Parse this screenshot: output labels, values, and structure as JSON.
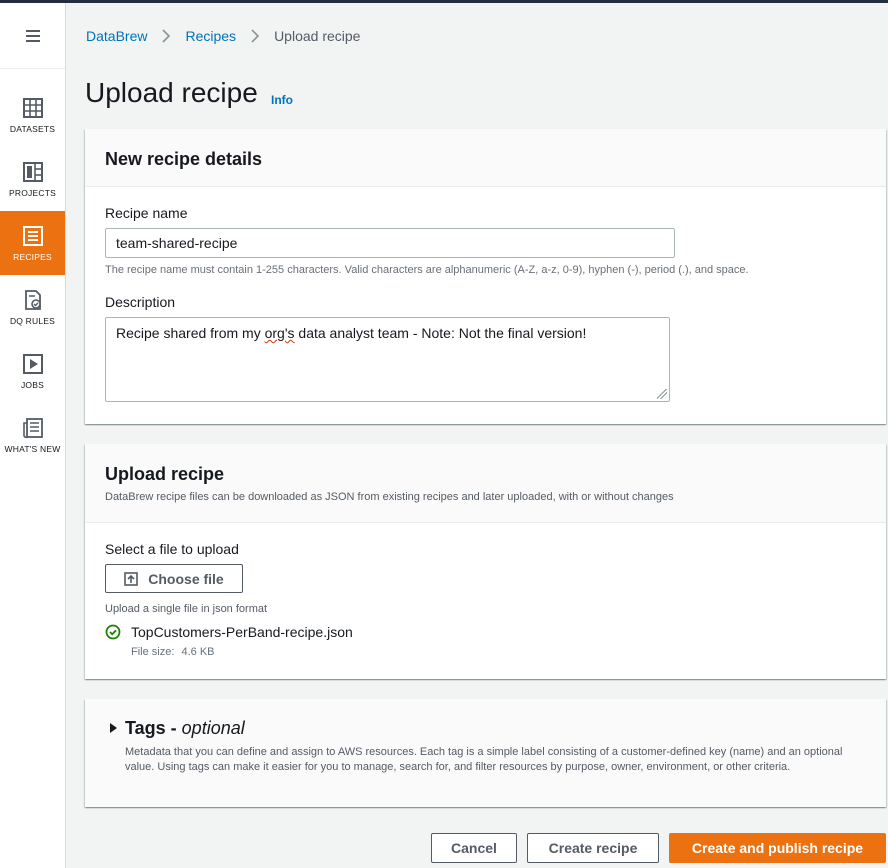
{
  "nav": {
    "menu_icon": "hamburger-menu-icon",
    "items": [
      {
        "label": "DATASETS",
        "icon": "table-grid-icon",
        "active": false
      },
      {
        "label": "PROJECTS",
        "icon": "project-grid-icon",
        "active": false
      },
      {
        "label": "RECIPES",
        "icon": "recipe-list-icon",
        "active": true
      },
      {
        "label": "DQ RULES",
        "icon": "dq-rules-icon",
        "active": false
      },
      {
        "label": "JOBS",
        "icon": "play-job-icon",
        "active": false
      },
      {
        "label": "WHAT'S NEW",
        "icon": "newspaper-icon",
        "active": false
      }
    ]
  },
  "breadcrumb": {
    "items": [
      "DataBrew",
      "Recipes"
    ],
    "current": "Upload recipe"
  },
  "page": {
    "title": "Upload recipe",
    "info_link": "Info"
  },
  "details": {
    "heading": "New recipe details",
    "name_label": "Recipe name",
    "name_value": "team-shared-recipe",
    "name_hint": "The recipe name must contain 1-255 characters. Valid characters are alphanumeric (A-Z, a-z, 0-9), hyphen (-), period (.), and space.",
    "description_label": "Description",
    "description_before": "Recipe shared from my ",
    "description_misspelled": "org's",
    "description_after": " data analyst team - Note: Not the final version!"
  },
  "upload": {
    "heading": "Upload recipe",
    "subtitle": "DataBrew recipe files can be downloaded as JSON from existing recipes and later uploaded, with or without changes",
    "select_label": "Select a file to upload",
    "choose_button": "Choose file",
    "hint": "Upload a single file in json format",
    "file_name": "TopCustomers-PerBand-recipe.json",
    "file_size_label": "File size:",
    "file_size_value": "4.6 KB",
    "status_color": "#1d8102"
  },
  "tags": {
    "heading": "Tags - ",
    "heading_optional": "optional",
    "description": "Metadata that you can define and assign to AWS resources. Each tag is a simple label consisting of a customer-defined key (name) and an optional value. Using tags can make it easier for you to manage, search for, and filter resources by purpose, owner, environment, or other criteria."
  },
  "actions": {
    "cancel": "Cancel",
    "create": "Create recipe",
    "create_publish": "Create and publish recipe"
  },
  "colors": {
    "accent": "#ec7211",
    "link": "#0073bb"
  }
}
